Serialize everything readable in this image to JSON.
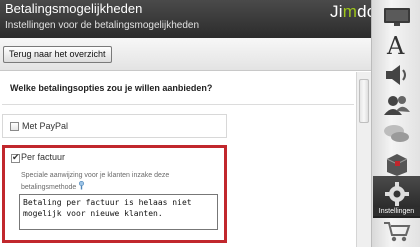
{
  "header": {
    "title": "Betalingsmogelijkheden",
    "subtitle": "Instellingen voor de betalingsmogelijkheden",
    "logo_main": "Ji",
    "logo_accent": "m",
    "logo_end": "do"
  },
  "toolbar": {
    "back_label": "Terug naar het overzicht"
  },
  "form": {
    "question": "Welke betalingsopties zou je willen aanbieden?",
    "options": [
      {
        "label": "Met PayPal",
        "checked": false
      },
      {
        "label": "Per factuur",
        "checked": true
      }
    ],
    "help_text": "Speciale aanwijzing voor je klanten inzake deze betalingsmethode",
    "textarea_value": "Betaling per factuur is helaas niet mogelijk voor nieuwe klanten."
  },
  "sidebar": {
    "items": [
      {
        "icon": "monitor-icon"
      },
      {
        "icon": "font-icon"
      },
      {
        "icon": "speaker-icon"
      },
      {
        "icon": "users-icon"
      },
      {
        "icon": "chat-icon"
      },
      {
        "icon": "package-icon"
      },
      {
        "icon": "settings-gear-icon"
      },
      {
        "icon": "cart-icon"
      }
    ],
    "active_label": "Instellingen"
  },
  "colors": {
    "highlight": "#c1272d",
    "header_bg": "#2c2c2c",
    "logo_accent": "#9ec61a"
  }
}
